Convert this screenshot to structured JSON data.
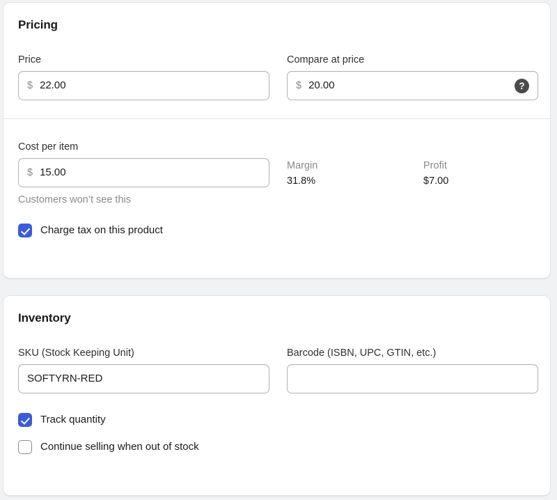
{
  "pricing": {
    "title": "Pricing",
    "price": {
      "label": "Price",
      "currency_symbol": "$",
      "value": "22.00",
      "placeholder": "0.00"
    },
    "compare_at_price": {
      "label": "Compare at price",
      "currency_symbol": "$",
      "value": "20.00",
      "placeholder": "0.00",
      "help_icon": "question-mark-circle-icon",
      "help_icon_glyph": "?"
    },
    "cost_per_item": {
      "label": "Cost per item",
      "currency_symbol": "$",
      "value": "15.00",
      "placeholder": "0.00",
      "help_text": "Customers won’t see this"
    },
    "margin": {
      "label": "Margin",
      "value": "31.8%"
    },
    "profit": {
      "label": "Profit",
      "value": "$7.00"
    },
    "charge_tax": {
      "label": "Charge tax on this product",
      "checked": true
    }
  },
  "inventory": {
    "title": "Inventory",
    "sku": {
      "label": "SKU (Stock Keeping Unit)",
      "value": "SOFTYRN-RED",
      "placeholder": ""
    },
    "barcode": {
      "label": "Barcode (ISBN, UPC, GTIN, etc.)",
      "value": "",
      "placeholder": ""
    },
    "track_quantity": {
      "label": "Track quantity",
      "checked": true
    },
    "continue_selling": {
      "label": "Continue selling when out of stock",
      "checked": false
    }
  },
  "colors": {
    "page_background": "#f1f2f4",
    "card_background": "#ffffff",
    "card_border": "#e3e4e6",
    "text_primary": "#1a1a1a",
    "text_secondary": "#8a8a8a",
    "input_border": "#b0b2b6",
    "checkbox_accent": "#3b5bdb",
    "help_icon_background": "#4a4a4a"
  }
}
